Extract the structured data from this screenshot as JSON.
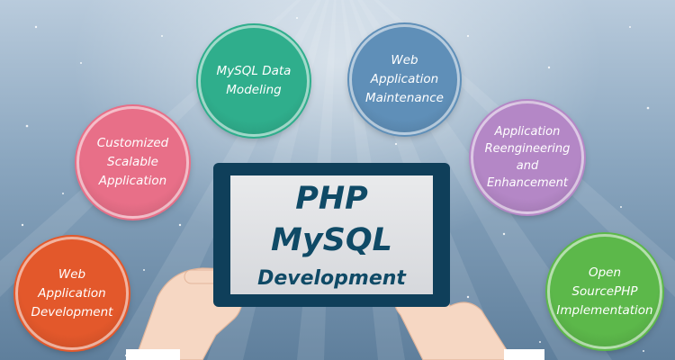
{
  "title": {
    "line1": "PHP",
    "line2": "MySQL",
    "line3": "Development"
  },
  "services": [
    {
      "lines": [
        "Web",
        "Application",
        "Development"
      ],
      "color": "#e3582b"
    },
    {
      "lines": [
        "Customized",
        "Scalable",
        "Application"
      ],
      "color": "#e86f88"
    },
    {
      "lines": [
        "MySQL Data",
        "Modeling"
      ],
      "color": "#2fae8c"
    },
    {
      "lines": [
        "Web",
        "Application",
        "Maintenance"
      ],
      "color": "#5f8fb8"
    },
    {
      "lines": [
        "Application",
        "Reengineering",
        "and",
        "Enhancement"
      ],
      "color": "#b487c6"
    },
    {
      "lines": [
        "Open",
        "SourcePHP",
        "Implementation"
      ],
      "color": "#5cb84a"
    }
  ],
  "colors": {
    "tablet_frame": "#0f3f5a",
    "title_text": "#0f4a66",
    "skin": "#f6d7c3"
  }
}
